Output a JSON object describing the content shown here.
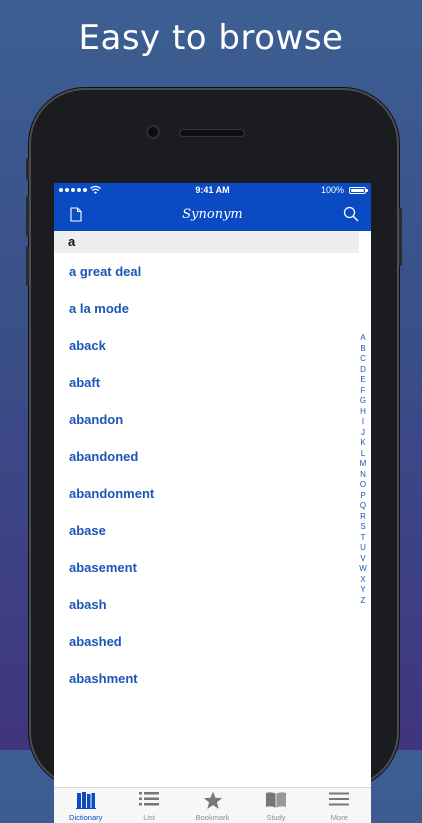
{
  "headline": "Easy to browse",
  "status_bar": {
    "time": "9:41 AM",
    "battery": "100%"
  },
  "nav": {
    "title": "Synonym",
    "left_icon": "document-icon",
    "right_icon": "search-icon"
  },
  "section_header": "a",
  "words": [
    "a great deal",
    "a la mode",
    "aback",
    "abaft",
    "abandon",
    "abandoned",
    "abandonment",
    "abase",
    "abasement",
    "abash",
    "abashed",
    "abashment"
  ],
  "index_letters": [
    "A",
    "B",
    "C",
    "D",
    "E",
    "F",
    "G",
    "H",
    "I",
    "J",
    "K",
    "L",
    "M",
    "N",
    "O",
    "P",
    "Q",
    "R",
    "S",
    "T",
    "U",
    "V",
    "W",
    "X",
    "Y",
    "Z"
  ],
  "tabs": [
    {
      "label": "Dictionary",
      "icon": "books-icon",
      "active": true
    },
    {
      "label": "List",
      "icon": "list-icon",
      "active": false
    },
    {
      "label": "Bookmark",
      "icon": "star-icon",
      "active": false
    },
    {
      "label": "Study",
      "icon": "open-book-icon",
      "active": false
    },
    {
      "label": "More",
      "icon": "menu-icon",
      "active": false
    }
  ],
  "colors": {
    "accent": "#0a4bc4",
    "word": "#1c56b6",
    "inactive": "#8e8e93"
  }
}
